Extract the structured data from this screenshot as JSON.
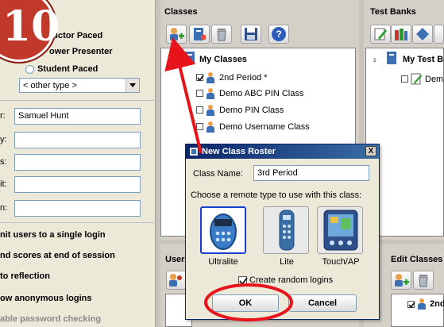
{
  "session_types": {
    "instructor": "ructor Paced",
    "presenter": "ower Presenter",
    "student": "Student Paced",
    "other_selected": "< other type >"
  },
  "form": {
    "instructor_label": "r:",
    "instructor_value": "Samuel Hunt",
    "labels": [
      "y:",
      "s:",
      "it:",
      "n:"
    ]
  },
  "options": [
    "nit users to a single login",
    "nd scores at end of session",
    "to reflection",
    "ow anonymous logins",
    "able password checking"
  ],
  "classes": {
    "title": "Classes",
    "root": "My Classes",
    "items": [
      {
        "label": "2nd Period *",
        "checked": true
      },
      {
        "label": "Demo ABC PIN Class",
        "checked": false
      },
      {
        "label": "Demo PIN Class",
        "checked": false
      },
      {
        "label": "Demo Username Class",
        "checked": false
      }
    ]
  },
  "test_banks": {
    "title": "Test Banks",
    "root": "My Test B",
    "item": "Dem"
  },
  "dialog": {
    "title": "New Class Roster",
    "class_name_label": "Class Name:",
    "class_name_value": "3rd Period",
    "choose_label": "Choose a remote type to use with this class:",
    "remotes": [
      {
        "label": "Ultralite",
        "selected": true
      },
      {
        "label": "Lite",
        "selected": false
      },
      {
        "label": "Touch/AP",
        "selected": false
      }
    ],
    "random_logins_label": "Create random logins",
    "random_logins_checked": true,
    "ok_label": "OK",
    "cancel_label": "Cancel",
    "close_glyph": "X"
  },
  "users_panel": {
    "title": "User"
  },
  "edit_classes": {
    "title": "Edit Classes",
    "item": "2nd"
  },
  "step_badge": "10",
  "colors": {
    "annotation_red": "#e8141c",
    "badge_red": "#c0392b",
    "selected_border": "#1a3fd0"
  },
  "icons": [
    "add-class-icon",
    "import-class-icon",
    "trash-icon",
    "save-icon",
    "help-icon"
  ]
}
